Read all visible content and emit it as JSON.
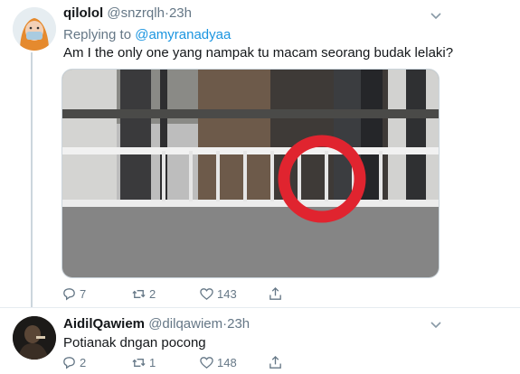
{
  "tweet1": {
    "name": "qilolol",
    "handle": "@snzrqlh",
    "separator": "·",
    "time": "23h",
    "replying_prefix": "Replying to",
    "replying_to": "@amyranadyaa",
    "text": "Am I the only one yang nampak tu macam seorang budak lelaki?",
    "actions": {
      "replies": "7",
      "retweets": "2",
      "likes": "143"
    }
  },
  "tweet2": {
    "name": "AidilQawiem",
    "handle": "@dilqawiem",
    "separator": "·",
    "time": "23h",
    "text": "Potianak dngan pocong",
    "actions": {
      "replies": "2",
      "retweets": "1",
      "likes": "148"
    }
  },
  "icons": [
    "chevron-down-icon",
    "reply-icon",
    "retweet-icon",
    "like-icon",
    "share-icon"
  ],
  "colors": {
    "link": "#1b95e0",
    "meta": "#657786",
    "circle": "#e0242f"
  }
}
